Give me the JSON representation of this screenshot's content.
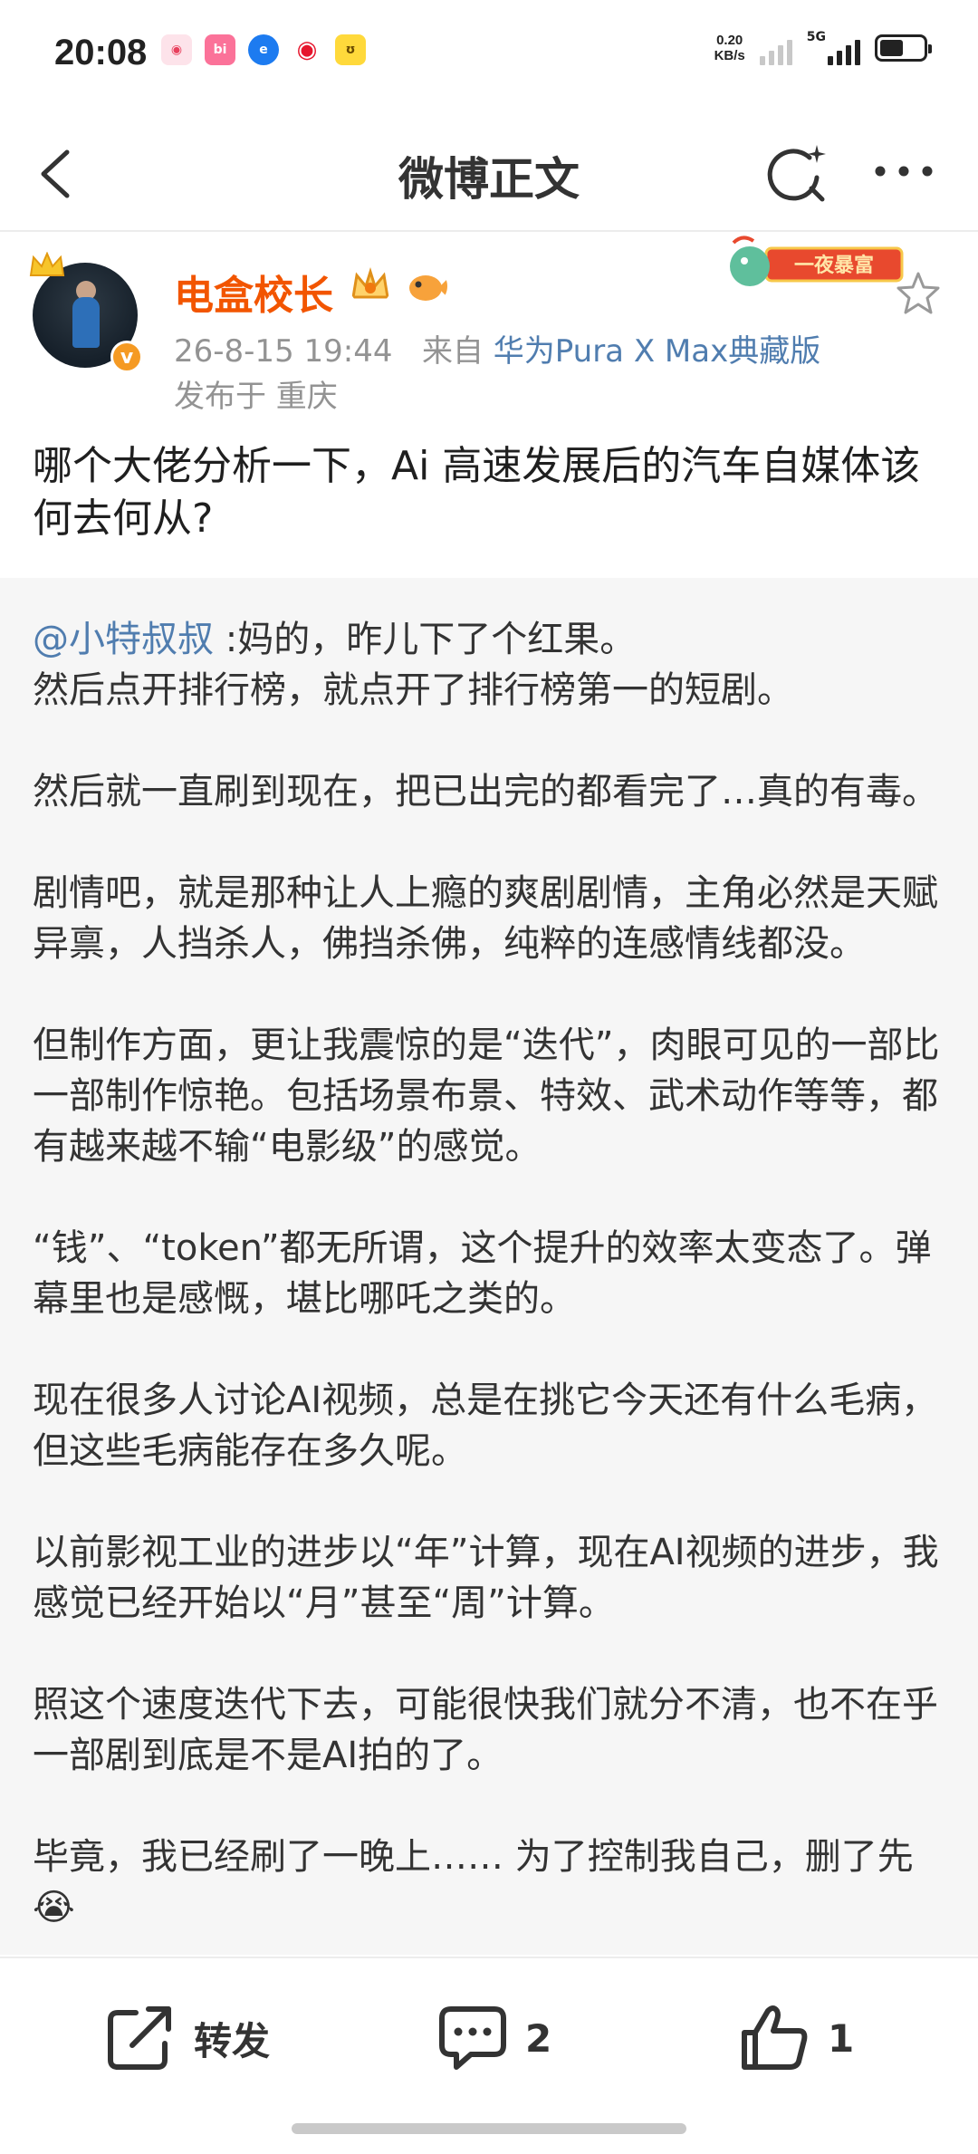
{
  "status": {
    "time": "20:08",
    "net_speed_value": "0.20",
    "net_speed_unit": "KB/s",
    "network": "5G",
    "battery_level": 0.55
  },
  "nav": {
    "title": "微博正文"
  },
  "post": {
    "author": "电盒校长",
    "badge_banner": "一夜暴富",
    "timestamp": "26-8-15 19:44",
    "source_prefix": "来自",
    "source": "华为Pura X Max典藏版",
    "location": "发布于 重庆",
    "text": "哪个大佬分析一下，Ai 高速发展后的汽车自媒体该何去何从?"
  },
  "repost": {
    "mention": "@小特叔叔",
    "body": " :妈的，昨儿下了个红果。\n然后点开排行榜，就点开了排行榜第一的短剧。\n\n然后就一直刷到现在，把已出完的都看完了…真的有毒。\n\n剧情吧，就是那种让人上瘾的爽剧剧情，主角必然是天赋异禀，人挡杀人，佛挡杀佛，纯粹的连感情线都没。\n\n但制作方面，更让我震惊的是“迭代”，肉眼可见的一部比一部制作惊艳。包括场景布景、特效、武术动作等等，都有越来越不输“电影级”的感觉。\n\n“钱”、“token”都无所谓，这个提升的效率太变态了。弹幕里也是感慨，堪比哪吒之类的。\n\n现在很多人讨论AI视频，总是在挑它今天还有什么毛病，但这些毛病能存在多久呢。\n\n以前影视工业的进步以“年”计算，现在AI视频的进步，我感觉已经开始以“月”甚至“周”计算。\n\n照这个速度迭代下去，可能很快我们就分不清，也不在乎一部剧到底是不是AI拍的了。\n\n毕竟，我已经刷了一晚上…… 为了控制我自己，删了先",
    "trailing_emoji": "😭"
  },
  "actions": {
    "repost_label": "转发",
    "comment_count": "2",
    "like_count": "1"
  }
}
